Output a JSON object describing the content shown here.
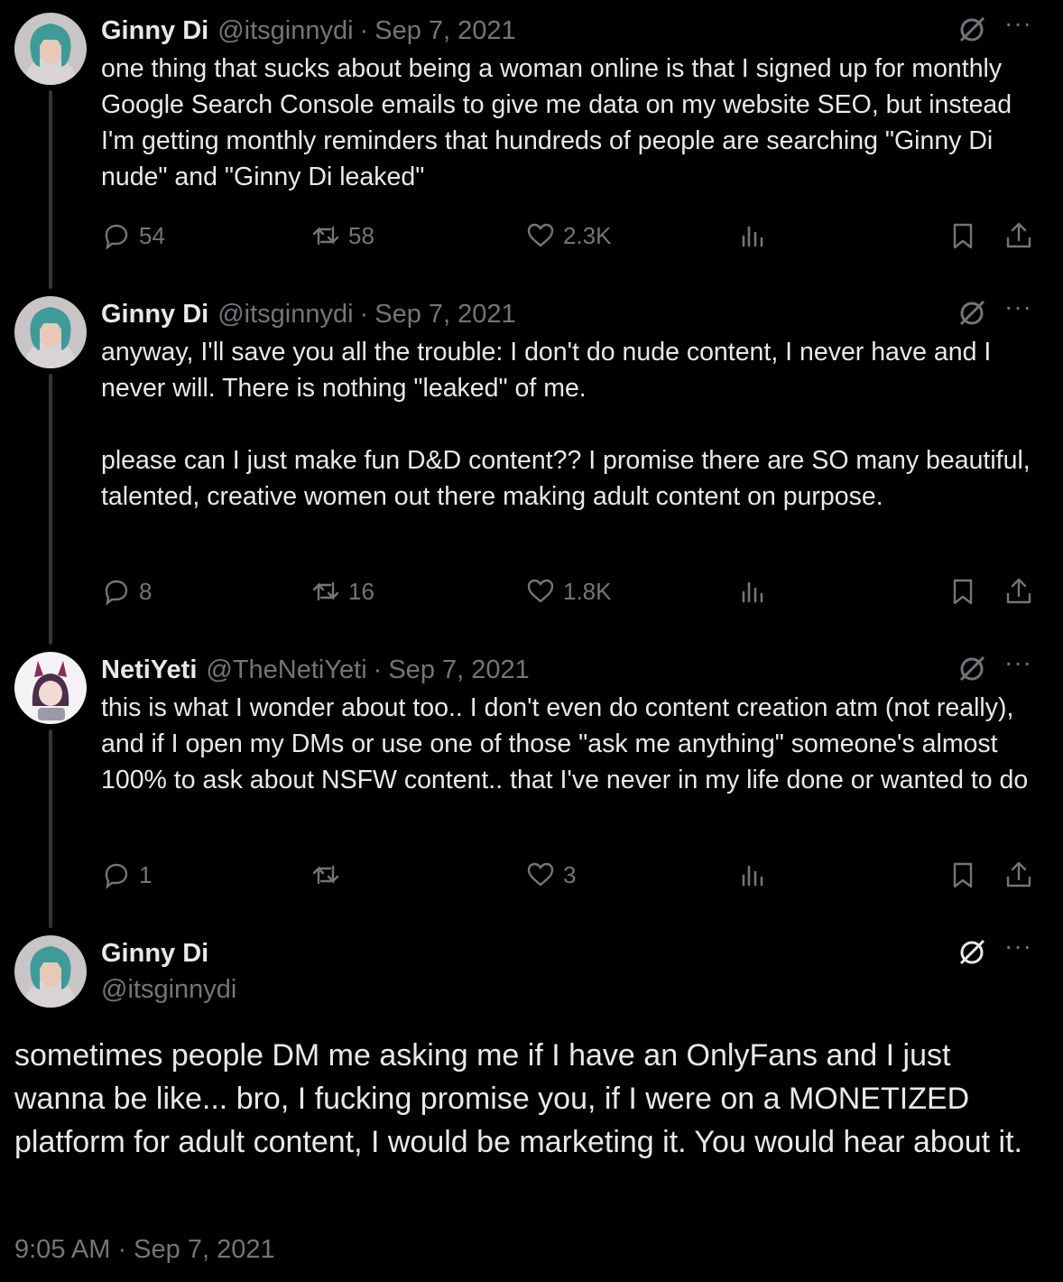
{
  "tweets": [
    {
      "name": "Ginny Di",
      "handle": "@itsginnydi",
      "sep": "·",
      "date": "Sep 7, 2021",
      "text": "one thing that sucks about being a woman online is that I signed up for monthly Google Search Console emails to give me data on my website SEO, but instead I'm getting monthly reminders that hundreds of people are searching \"Ginny Di nude\" and \"Ginny Di leaked\"",
      "replies": "54",
      "reposts": "58",
      "likes": "2.3K"
    },
    {
      "name": "Ginny Di",
      "handle": "@itsginnydi",
      "sep": "·",
      "date": "Sep 7, 2021",
      "text": "anyway, I'll save you all the trouble: I don't do nude content, I never have and I never will. There is nothing \"leaked\" of me.\n\nplease can I just make fun D&D content?? I promise there are SO many beautiful, talented, creative women out there making adult content on purpose.",
      "replies": "8",
      "reposts": "16",
      "likes": "1.8K"
    },
    {
      "name": "NetiYeti",
      "handle": "@TheNetiYeti",
      "sep": "·",
      "date": "Sep 7, 2021",
      "text": "this is what I wonder about too.. I don't even do content creation atm (not really), and if I open my DMs or use one of those \"ask me anything\" someone's almost 100% to ask about NSFW content.. that I've never in my life done or wanted to do",
      "replies": "1",
      "reposts": "",
      "likes": "3"
    }
  ],
  "main": {
    "name": "Ginny Di",
    "handle": "@itsginnydi",
    "text": "sometimes people DM me asking me if I have an OnlyFans and I just wanna be like... bro, I fucking promise you, if I were on a MONETIZED platform for adult content, I would be marketing it. You would hear about it.",
    "timestamp": "9:05 AM · Sep 7, 2021"
  },
  "ui": {
    "more": "···"
  },
  "colors": {
    "background": "#000000",
    "text": "#e7e9ea",
    "muted": "#71767b",
    "thread_line": "#333639"
  },
  "icons": [
    "reply-icon",
    "repost-icon",
    "like-icon",
    "views-icon",
    "bookmark-icon",
    "share-icon",
    "grok-icon",
    "more-icon"
  ]
}
